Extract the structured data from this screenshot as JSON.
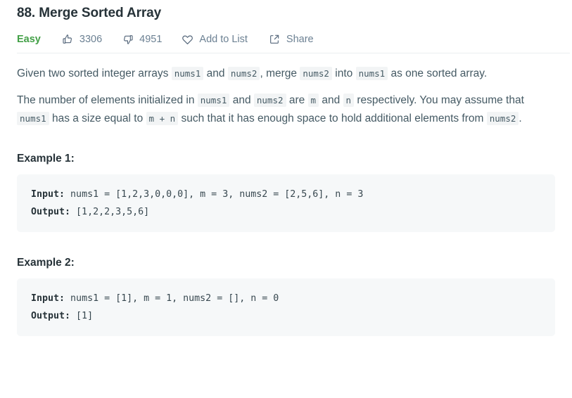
{
  "problem": {
    "title": "88. Merge Sorted Array",
    "difficulty": "Easy"
  },
  "actions": {
    "likes": {
      "icon": "thumbs-up-icon",
      "count": "3306"
    },
    "dislikes": {
      "icon": "thumbs-down-icon",
      "count": "4951"
    },
    "add_to_list": {
      "icon": "heart-icon",
      "label": "Add to List"
    },
    "share": {
      "icon": "share-icon",
      "label": "Share"
    }
  },
  "description": {
    "paragraph1": {
      "t1": "Given two sorted integer arrays ",
      "c1": "nums1",
      "t2": " and ",
      "c2": "nums2",
      "t3": ", merge ",
      "c3": "nums2",
      "t4": " into ",
      "c4": "nums1",
      "t5": " as one sorted array."
    },
    "paragraph2": {
      "t1": "The number of elements initialized in ",
      "c1": "nums1",
      "t2": " and ",
      "c2": "nums2",
      "t3": " are ",
      "c3": "m",
      "t4": " and ",
      "c4": "n",
      "t5": " respectively. You may assume that ",
      "c5": "nums1",
      "t6": " has a size equal to ",
      "c6": "m + n",
      "t7": " such that it has enough space to hold additional elements from ",
      "c7": "nums2",
      "t8": "."
    }
  },
  "examples": [
    {
      "heading": "Example 1:",
      "input_label": "Input:",
      "input_value": " nums1 = [1,2,3,0,0,0], m = 3, nums2 = [2,5,6], n = 3",
      "output_label": "Output:",
      "output_value": " [1,2,2,3,5,6]"
    },
    {
      "heading": "Example 2:",
      "input_label": "Input:",
      "input_value": " nums1 = [1], m = 1, nums2 = [], n = 0",
      "output_label": "Output:",
      "output_value": " [1]"
    }
  ],
  "colors": {
    "easy_green": "#43a047",
    "text": "#455a64",
    "muted": "#6c8193",
    "code_bg": "#f6f8f9",
    "inline_code_bg": "#f2f4f5"
  }
}
